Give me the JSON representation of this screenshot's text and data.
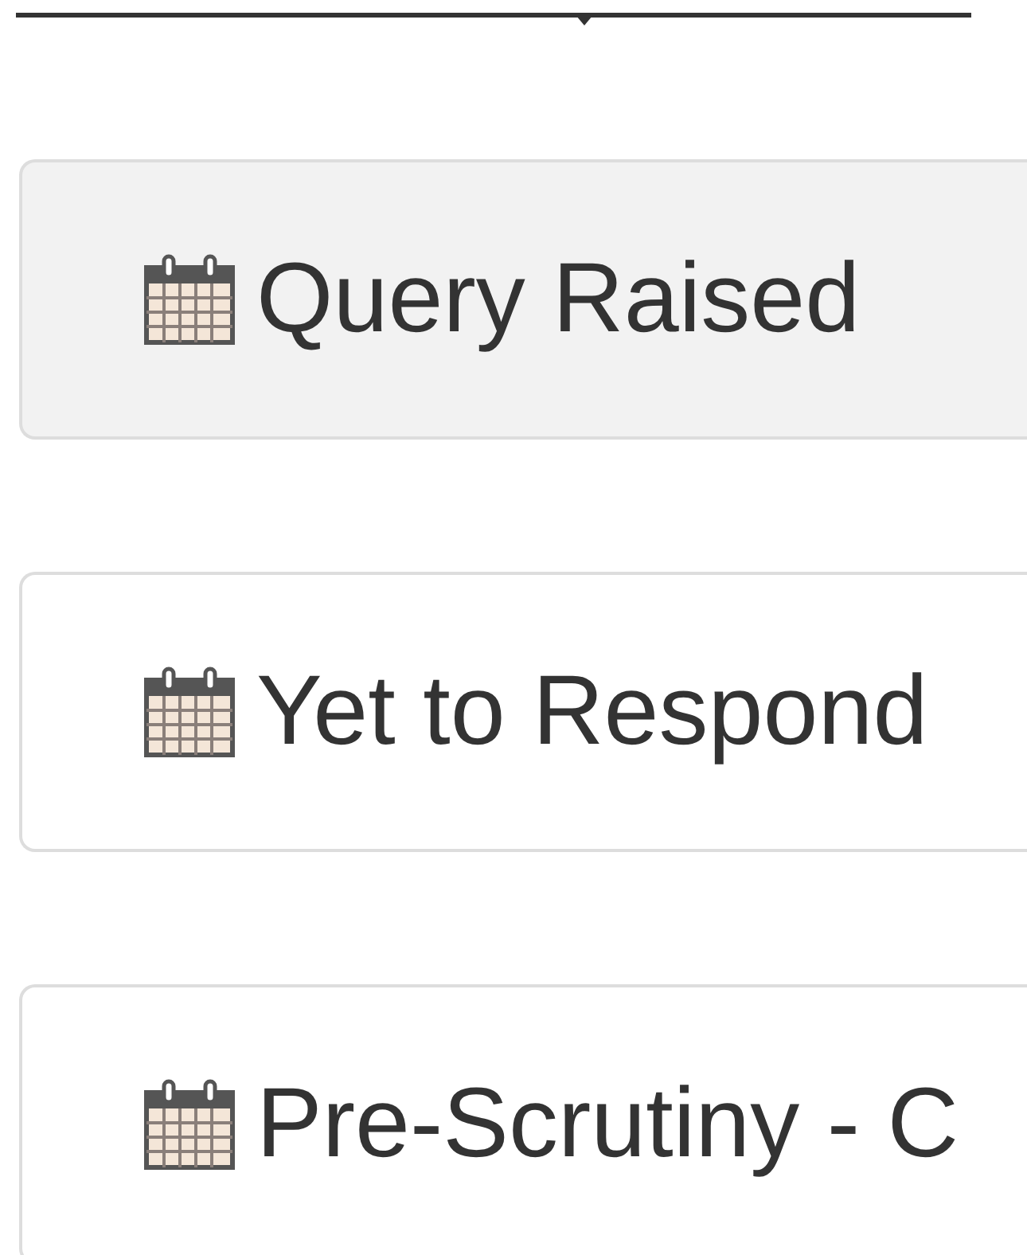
{
  "items": [
    {
      "label": "Query Raised",
      "selected": true
    },
    {
      "label": "Yet to Respond",
      "selected": false
    },
    {
      "label": "Pre-Scrutiny - C",
      "selected": false
    }
  ]
}
